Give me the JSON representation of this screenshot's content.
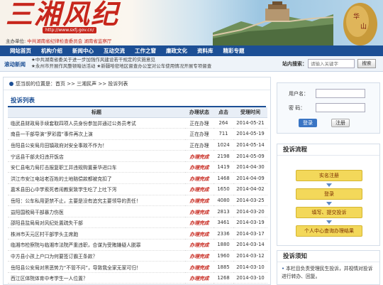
{
  "header": {
    "logo": "三湘风纪",
    "url": "http://www.sxfj.gov.cn/",
    "sponsor_prefix": "主办单位:",
    "sponsor_main": "中共湖南省纪律检查委员会",
    "sponsor_second": "湖南省监察厅"
  },
  "nav": [
    "网站首页",
    "机构介绍",
    "新闻中心",
    "互动交流",
    "工作之窗",
    "廉政文化",
    "资料库",
    "精彩专题"
  ],
  "newsbar": {
    "label": "滚动新闻",
    "ticker": [
      "★中共湖南省委关于进一步加强作风建设若干规定的实施意见",
      "★永州市开展作风整顿暗访活动  ★新疆哈密地区督查办公室对公车使用情况开展专项督查"
    ],
    "search_label": "站内搜索：",
    "search_placeholder": "请输入关键字",
    "search_button": "搜索"
  },
  "breadcrumb": "您当前的位置是：首页 >> 三湘民声 >> 投诉列表",
  "list": {
    "title": "投诉列表",
    "columns": [
      "标题",
      "办理状态",
      "点击",
      "受理时间"
    ],
    "rows": [
      {
        "title": "临武县财政局手续套取四项人员身份参加并通过公务员考试",
        "status": "正在办理",
        "clicks": "264",
        "date": "2014-05-21",
        "done": false
      },
      {
        "title": "南县一干部导演“罗彩霞”事件再次上演",
        "status": "正在办理",
        "clicks": "711",
        "date": "2014-05-19",
        "done": false
      },
      {
        "title": "岳阳县公安局月田镇政府对安全事故不作为！",
        "status": "正在办理",
        "clicks": "1024",
        "date": "2014-05-14",
        "done": false
      },
      {
        "title": "宁远县干部夫妇违开饭店",
        "status": "办理完成",
        "clicks": "2198",
        "date": "2014-05-09",
        "done": true
      },
      {
        "title": "安仁县电力局打击报复职工并违规购置豪华进口车",
        "status": "办理完成",
        "clicks": "1419",
        "date": "2014-04-30",
        "done": true
      },
      {
        "title": "洪江市安江电站老百姓的土地赔偿款都被克扣了",
        "status": "办理完成",
        "clicks": "1468",
        "date": "2014-04-09",
        "done": true
      },
      {
        "title": "嘉禾县田心中学索死者闹教案致学生吃了上吐下泻",
        "status": "办理完成",
        "clicks": "1650",
        "date": "2014-04-02",
        "done": true
      },
      {
        "title": "岳阳：公车私用更禁不止，主要是没有追究主要领导的责任！",
        "status": "办理完成",
        "clicks": "4080",
        "date": "2014-03-25",
        "done": true
      },
      {
        "title": "益阳国税局干部暴力伤医",
        "status": "办理完成",
        "clicks": "2813",
        "date": "2014-03-20",
        "done": true
      },
      {
        "title": "邵阳县监局局对风纪处置疏失干部",
        "status": "办理完成",
        "clicks": "3461",
        "date": "2014-03-19",
        "done": true
      },
      {
        "title": "株洲市天元区村干部学头主席跑",
        "status": "办理完成",
        "clicks": "2336",
        "date": "2014-03-17",
        "done": true
      },
      {
        "title": "临湘市检察院与临湘市法院严重违职，合谋为受贿嫌疑人脱罪",
        "status": "办理完成",
        "clicks": "1880",
        "date": "2014-03-14",
        "done": true
      },
      {
        "title": "中方县小孩上户口为何要签订霸王条款？",
        "status": "办理完成",
        "clicks": "1960",
        "date": "2014-03-12",
        "done": true
      },
      {
        "title": "岳阳县公安局对黑恶势力“不管不问”，导致我全家无家可归！",
        "status": "办理完成",
        "clicks": "1885",
        "date": "2014-03-10",
        "done": true
      },
      {
        "title": "西江区体院体育中考学生一人位置？",
        "status": "办理完成",
        "clicks": "1268",
        "date": "2014-03-10",
        "done": true
      }
    ]
  },
  "login": {
    "username_label": "用户名：",
    "password_label": "密  码：",
    "login_button": "登录",
    "register_button": "注册"
  },
  "flow": {
    "title": "投诉流程",
    "steps": [
      "实名注册",
      "登录",
      "填写、提交投诉",
      "个人中心查询办理结果"
    ]
  },
  "notice": {
    "title": "投诉须知",
    "text": "本栏目负责受理民生投诉，并视情对投诉进行转办、回复。"
  }
}
